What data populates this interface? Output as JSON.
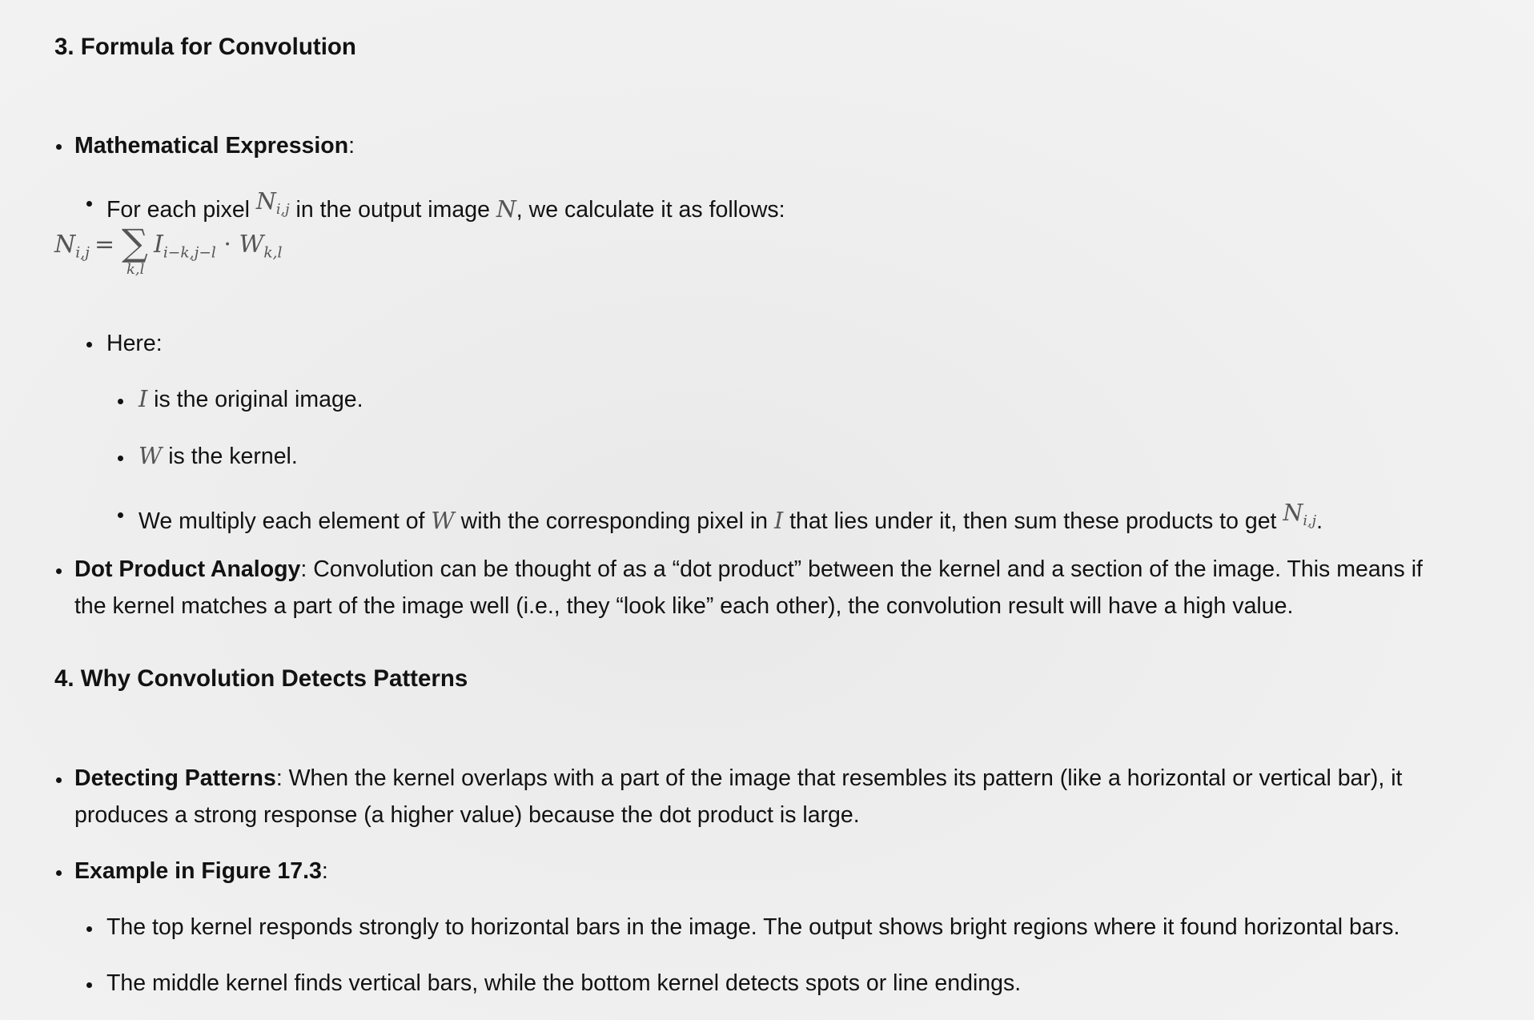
{
  "section3": {
    "heading": "3. Formula for Convolution",
    "math_expr": {
      "label": "Mathematical Expression",
      "colon": ":"
    },
    "for_each": {
      "pre": "For each pixel ",
      "var_n": "N",
      "sub_ij": "i,j",
      "mid": " in the output image ",
      "var_n2": "N",
      "post": ", we calculate it as follows:"
    },
    "formula": {
      "lhs": "N",
      "lhs_sub": "i,j",
      "eq": " = ",
      "sigma": "∑",
      "sum_sub": "k,l",
      "i_var": "I",
      "i_sub": "i−k,j−l",
      "dot": " · ",
      "w_var": "W",
      "w_sub": "k,l"
    },
    "here": "Here:",
    "item_i": {
      "var": "I",
      "text": " is the original image."
    },
    "item_w": {
      "var": "W",
      "text": " is the kernel."
    },
    "item_mult": {
      "pre": "We multiply each element of ",
      "var_w": "W",
      "mid": " with the corresponding pixel in ",
      "var_i": "I",
      "post": " that lies under it, then sum these products to get ",
      "var_n": "N",
      "sub": "i,j",
      "end": "."
    },
    "dot_product": {
      "label": "Dot Product Analogy",
      "line1": ": Convolution can be thought of as a “dot product” between the kernel and a section of the image. This means if",
      "line2": "the kernel matches a part of the image well (i.e., they “look like” each other), the convolution result will have a high value."
    }
  },
  "section4": {
    "heading": "4. Why Convolution Detects Patterns",
    "detecting": {
      "label": "Detecting Patterns",
      "line1": ": When the kernel overlaps with a part of the image that resembles its pattern (like a horizontal or vertical bar), it",
      "line2": "produces a strong response (a higher value) because the dot product is large."
    },
    "example": {
      "label": "Example in Figure 17.3",
      "colon": ":"
    },
    "top_kernel": "The top kernel responds strongly to horizontal bars in the image. The output shows bright regions where it found horizontal bars.",
    "middle_kernel": "The middle kernel finds vertical bars, while the bottom kernel detects spots or line endings."
  }
}
